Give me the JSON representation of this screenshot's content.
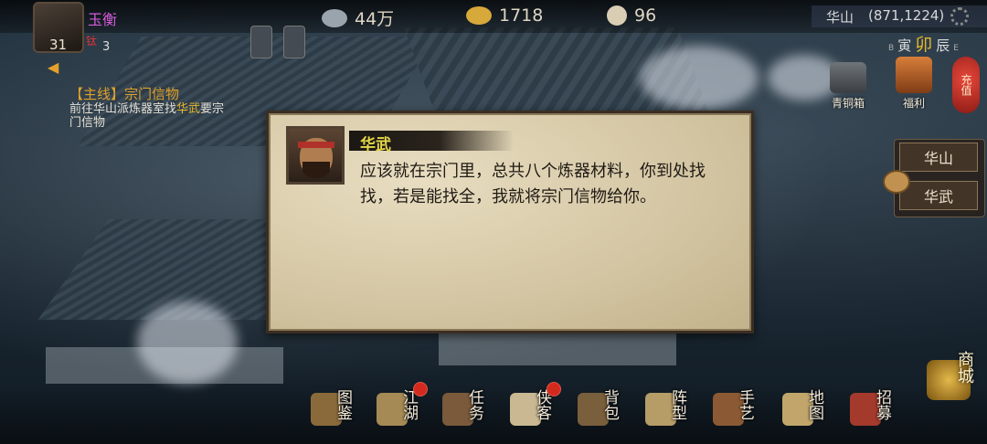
{
  "player": {
    "name": "玉衡",
    "level": "31",
    "sect_tag": "钛",
    "sect_count": "3"
  },
  "resources": [
    {
      "icon": "silver-ingot-icon",
      "value": "44万",
      "color": "#9aa4ad"
    },
    {
      "icon": "gold-ingot-icon",
      "value": "1718",
      "color": "#d7a83a"
    },
    {
      "icon": "bun-icon",
      "value": "96",
      "color": "#d9cdb4"
    }
  ],
  "location": {
    "name": "华山",
    "coords": "(871,1224)"
  },
  "time": {
    "prev_small": "B",
    "prev": "寅",
    "current": "卯",
    "next": "辰",
    "next_small": "E"
  },
  "quest": {
    "title": "【主线】宗门信物",
    "desc_prefix": "前往华山派炼器室找",
    "desc_highlight": "华武",
    "desc_suffix": "要宗门信物"
  },
  "right_icons": {
    "bronze_box": "青铜箱",
    "welfare": "福利",
    "recharge": "充值"
  },
  "side_nav": [
    "华山",
    "华武"
  ],
  "dialog": {
    "speaker": "华武",
    "text": "应该就在宗门里，总共八个炼器材料，你到处找找，若是能找全，我就将宗门信物给你。"
  },
  "bottom_nav": [
    {
      "label": "图鉴",
      "icon": "book-icon",
      "dot": false
    },
    {
      "label": "江湖",
      "icon": "scroll-icon",
      "dot": true
    },
    {
      "label": "任务",
      "icon": "brush-icon",
      "dot": false
    },
    {
      "label": "侠客",
      "icon": "hat-icon",
      "dot": true
    },
    {
      "label": "背包",
      "icon": "bag-icon",
      "dot": false
    },
    {
      "label": "阵型",
      "icon": "formation-icon",
      "dot": false
    },
    {
      "label": "手艺",
      "icon": "teapot-icon",
      "dot": false
    },
    {
      "label": "地图",
      "icon": "map-icon",
      "dot": false
    },
    {
      "label": "招募",
      "icon": "recruit-icon",
      "dot": false
    }
  ],
  "shop_label": "商城"
}
